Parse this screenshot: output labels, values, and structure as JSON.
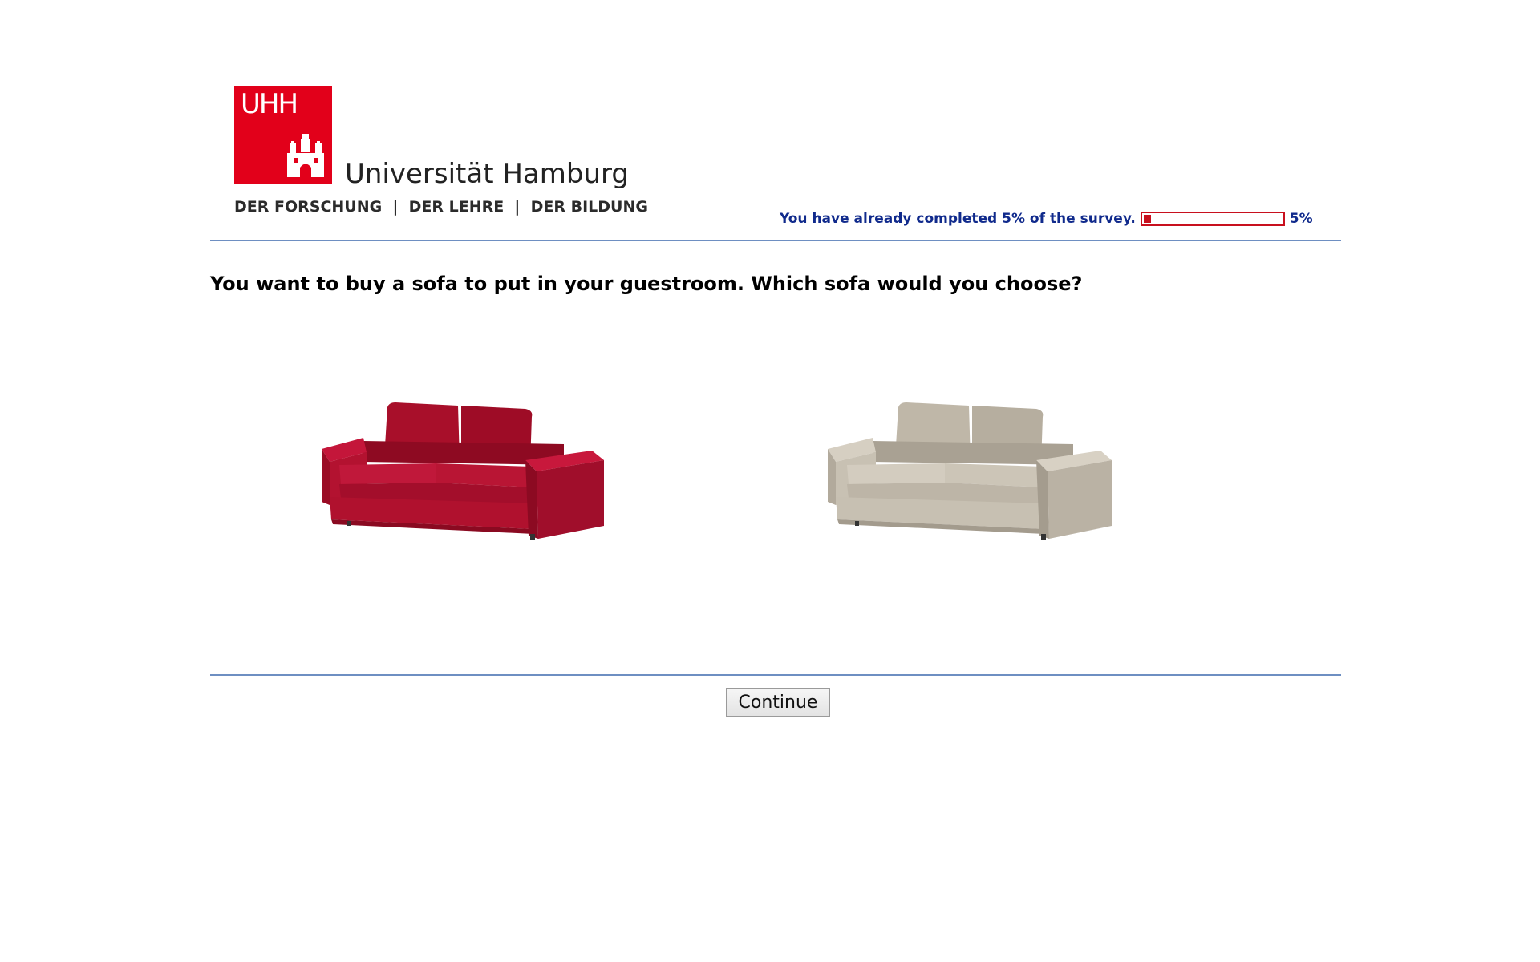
{
  "logo": {
    "abbreviation": "UHH",
    "name": "Universität Hamburg",
    "tagline": "DER FORSCHUNG  |  DER LEHRE  |  DER BILDUNG",
    "brand_color": "#e2001a"
  },
  "progress": {
    "text": "You have already completed 5% of the survey.",
    "percent_label": "5%",
    "value": 0.05,
    "bar_color": "#c8101e",
    "text_color": "#102a8c"
  },
  "question": "You want to buy a sofa to put in your guestroom. Which sofa would you choose?",
  "options": [
    {
      "id": "red-sofa",
      "color": "#b5122e"
    },
    {
      "id": "grey-sofa",
      "color": "#c9c2b4"
    }
  ],
  "continue_label": "Continue"
}
